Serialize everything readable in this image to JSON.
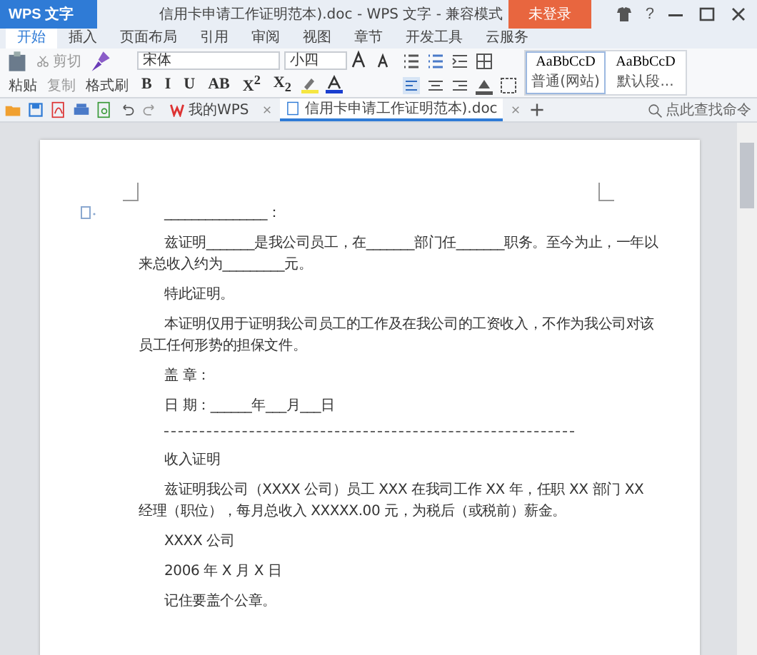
{
  "title_bar": {
    "app_menu": "WPS 文字",
    "title": "信用卡申请工作证明范本).doc - WPS 文字 - 兼容模式",
    "login": "未登录",
    "help": "?"
  },
  "ribbon_tabs": [
    {
      "label": "开始",
      "selected": true
    },
    {
      "label": "插入",
      "selected": false
    },
    {
      "label": "页面布局",
      "selected": false
    },
    {
      "label": "引用",
      "selected": false
    },
    {
      "label": "审阅",
      "selected": false
    },
    {
      "label": "视图",
      "selected": false
    },
    {
      "label": "章节",
      "selected": false
    },
    {
      "label": "开发工具",
      "selected": false
    },
    {
      "label": "云服务",
      "selected": false
    }
  ],
  "ribbon": {
    "paste": "粘贴",
    "cut": "剪切",
    "copy": "复制",
    "format_painter": "格式刷",
    "font_family": "宋体",
    "font_size": "小四",
    "format_buttons": [
      "B",
      "I",
      "U",
      "AB",
      "X$^{2}$",
      "X$_{2}$"
    ],
    "styles": [
      {
        "preview": "AaBbCcD",
        "name": "普通(网站)",
        "selected": true
      },
      {
        "preview": "AaBbCcD",
        "name": "默认段...",
        "selected": false
      }
    ]
  },
  "doc_tabs": [
    {
      "label": "我的WPS",
      "selected": false
    },
    {
      "label": "信用卡申请工作证明范本).doc",
      "selected": true
    }
  ],
  "search": {
    "placeholder": "点此查找命令"
  },
  "document": {
    "paragraphs": [
      {
        "kind": "text",
        "text": "_______________："
      },
      {
        "kind": "text",
        "text": "兹证明_______是我公司员工，在_______部门任_______职务。至今为止，一年以来总收入约为_________元。"
      },
      {
        "kind": "text",
        "text": "特此证明。"
      },
      {
        "kind": "text",
        "text": "本证明仅用于证明我公司员工的工作及在我公司的工资收入，不作为我公司对该员工任何形势的担保文件。"
      },
      {
        "kind": "text",
        "text": "盖 章："
      },
      {
        "kind": "text",
        "text": "日 期：______年___月___日"
      },
      {
        "kind": "rule"
      },
      {
        "kind": "text",
        "text": "收入证明"
      },
      {
        "kind": "text",
        "text": "兹证明我公司（XXXX 公司）员工 XXX 在我司工作 XX 年，任职 XX 部门 XX 经理（职位），每月总收入 XXXXX.00 元，为税后（或税前）薪金。"
      },
      {
        "kind": "text",
        "text": "XXXX 公司"
      },
      {
        "kind": "text",
        "text": "2006 年 X 月 X 日"
      },
      {
        "kind": "text",
        "text": "记住要盖个公章。"
      }
    ]
  }
}
